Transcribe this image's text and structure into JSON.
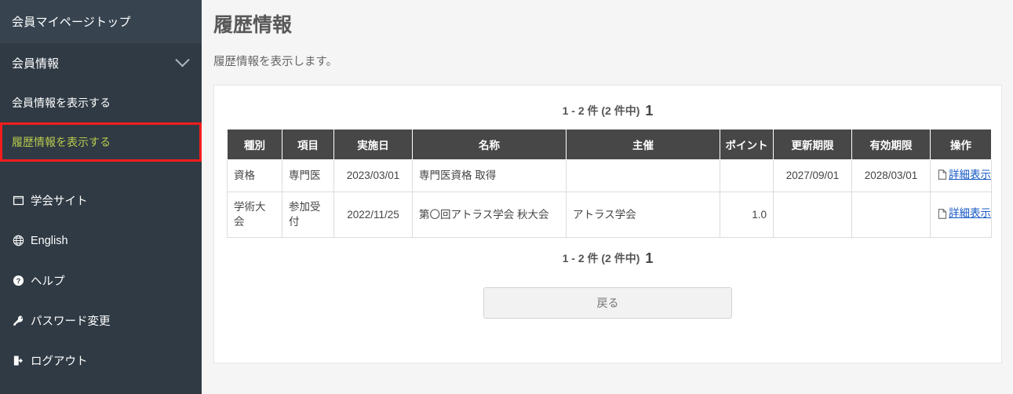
{
  "sidebar": {
    "top_item": {
      "label": "会員マイページトップ"
    },
    "group": {
      "label": "会員情報",
      "icon": "chevron-down-icon"
    },
    "sub_items": [
      {
        "label": "会員情報を表示する",
        "active": false
      },
      {
        "label": "履歴情報を表示する",
        "active": true
      }
    ],
    "links": [
      {
        "label": "学会サイト",
        "icon": "window-icon"
      },
      {
        "label": "English",
        "icon": "globe-icon"
      },
      {
        "label": "ヘルプ",
        "icon": "question-circle-icon"
      },
      {
        "label": "パスワード変更",
        "icon": "key-icon"
      },
      {
        "label": "ログアウト",
        "icon": "logout-icon"
      }
    ],
    "colors": {
      "background": "#2f3a44",
      "top_background": "#374450",
      "active_text": "#b9cb4e",
      "active_outline": "#f41d1d"
    }
  },
  "main": {
    "page_title": "履歴情報",
    "page_description": "履歴情報を表示します。",
    "pager_top": {
      "range": "1 - 2 件 (2 件中)",
      "current_page": "1"
    },
    "pager_bottom": {
      "range": "1 - 2 件 (2 件中)",
      "current_page": "1"
    },
    "back_button": "戻る",
    "table": {
      "headers": [
        "種別",
        "項目",
        "実施日",
        "名称",
        "主催",
        "ポイント",
        "更新期限",
        "有効期限",
        "操作"
      ],
      "rows": [
        {
          "type": "資格",
          "item": "専門医",
          "date": "2023/03/01",
          "name": "専門医資格 取得",
          "organizer": "",
          "points": "",
          "renewal_deadline": "2027/09/01",
          "valid_until": "2028/03/01",
          "action": "詳細表示",
          "action_icon": "document-icon"
        },
        {
          "type": "学術大会",
          "item": "参加受付",
          "date": "2022/11/25",
          "name": "第〇回アトラス学会 秋大会",
          "organizer": "アトラス学会",
          "points": "1.0",
          "renewal_deadline": "",
          "valid_until": "",
          "action": "詳細表示",
          "action_icon": "document-icon"
        }
      ]
    },
    "colors": {
      "header_bg": "#474747",
      "link": "#1758c4",
      "page_bg": "#f5f5f5",
      "card_bg": "#ffffff"
    }
  }
}
